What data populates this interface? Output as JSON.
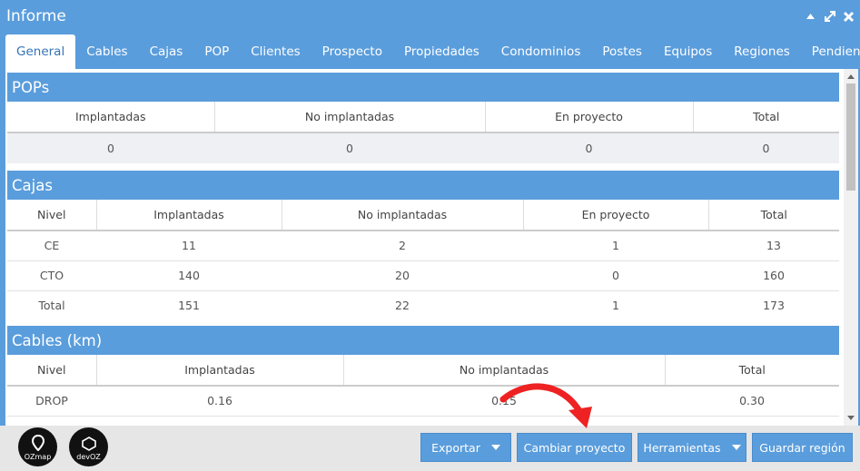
{
  "window": {
    "title": "Informe"
  },
  "tabs": [
    {
      "label": "General",
      "active": true
    },
    {
      "label": "Cables"
    },
    {
      "label": "Cajas"
    },
    {
      "label": "POP"
    },
    {
      "label": "Clientes"
    },
    {
      "label": "Prospecto"
    },
    {
      "label": "Propiedades"
    },
    {
      "label": "Condominios"
    },
    {
      "label": "Postes"
    },
    {
      "label": "Equipos"
    },
    {
      "label": "Regiones"
    },
    {
      "label": "Pendientes"
    }
  ],
  "pops": {
    "title": "POPs",
    "headers": [
      "Implantadas",
      "No implantadas",
      "En proyecto",
      "Total"
    ],
    "rows": [
      [
        "0",
        "0",
        "0",
        "0"
      ]
    ]
  },
  "cajas": {
    "title": "Cajas",
    "headers": [
      "Nivel",
      "Implantadas",
      "No implantadas",
      "En proyecto",
      "Total"
    ],
    "rows": [
      [
        "CE",
        "11",
        "2",
        "1",
        "13"
      ],
      [
        "CTO",
        "140",
        "20",
        "0",
        "160"
      ],
      [
        "Total",
        "151",
        "22",
        "1",
        "173"
      ]
    ]
  },
  "cables": {
    "title": "Cables (km)",
    "headers": [
      "Nivel",
      "Implantadas",
      "No implantadas",
      "Total"
    ],
    "rows": [
      [
        "DROP",
        "0.16",
        "0.15",
        "0.30"
      ]
    ]
  },
  "footer": {
    "logos": [
      "OZmap",
      "devOZ"
    ],
    "buttons": {
      "exportar": "Exportar",
      "cambiar": "Cambiar proyecto",
      "herramientas": "Herramientas",
      "guardar": "Guardar región"
    }
  },
  "colors": {
    "accent": "#5a9ddc",
    "annotation_arrow": "#ee2222"
  }
}
